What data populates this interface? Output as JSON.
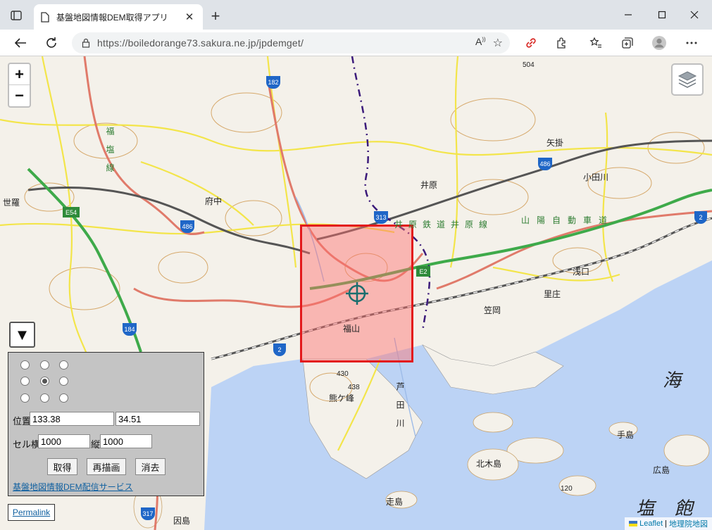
{
  "browser": {
    "tab_title": "基盤地図情報DEM取得アプリ",
    "url": "https://boiledorange73.sakura.ne.jp/jpdemget/"
  },
  "map": {
    "zoom_in": "+",
    "zoom_out": "−",
    "toggle_arrow": "▼",
    "places": {
      "fuchu": "府中",
      "fukuyama": "福山",
      "ihara": "井原",
      "yakake": "矢掛",
      "odagawa": "小田川",
      "satosho": "里庄",
      "asakuchi": "浅口",
      "kasaoka": "笠岡",
      "seko": "世羅",
      "kumagamine": "熊ケ峰",
      "ashida": "芦田川",
      "kitaki": "北木島",
      "teshima": "手島",
      "hiroshima": "広島",
      "shiraishi": "走島",
      "innoshima": "因島",
      "shiwaku_sea": "塩 飽",
      "sea": "海",
      "ihara_line": "井原鉄道井原線",
      "sanyo": "山陽自動車道",
      "fukuen": "福塩線",
      "elev_504": "504",
      "elev_430": "430",
      "elev_438": "438",
      "elev_120": "120"
    },
    "shields": {
      "r182": "182",
      "r486a": "486",
      "r486b": "486",
      "r313": "313",
      "r184": "184",
      "r2a": "2",
      "r2b": "2",
      "r317": "317",
      "e54": "E54",
      "e2": "E2"
    }
  },
  "panel": {
    "position_label": "位置",
    "lon": "133.38",
    "lat": "34.51",
    "cell_label": "セル横",
    "cell_w": "1000",
    "vert_label": "縦",
    "cell_h": "1000",
    "btn_get": "取得",
    "btn_redraw": "再描画",
    "btn_clear": "消去",
    "service_link": "基盤地図情報DEM配信サービス",
    "selected_radio": 4
  },
  "permalink": "Permalink",
  "attribution": {
    "leaflet": "Leaflet",
    "sep": "|",
    "gsi": "地理院地図"
  },
  "colors": {
    "accent_red": "#e31a1c",
    "selection_fill": "#ff9a9a",
    "sea": "#bcd3f5",
    "road_yellow": "#f3e54a",
    "expressway_green": "#3eaa4a"
  }
}
